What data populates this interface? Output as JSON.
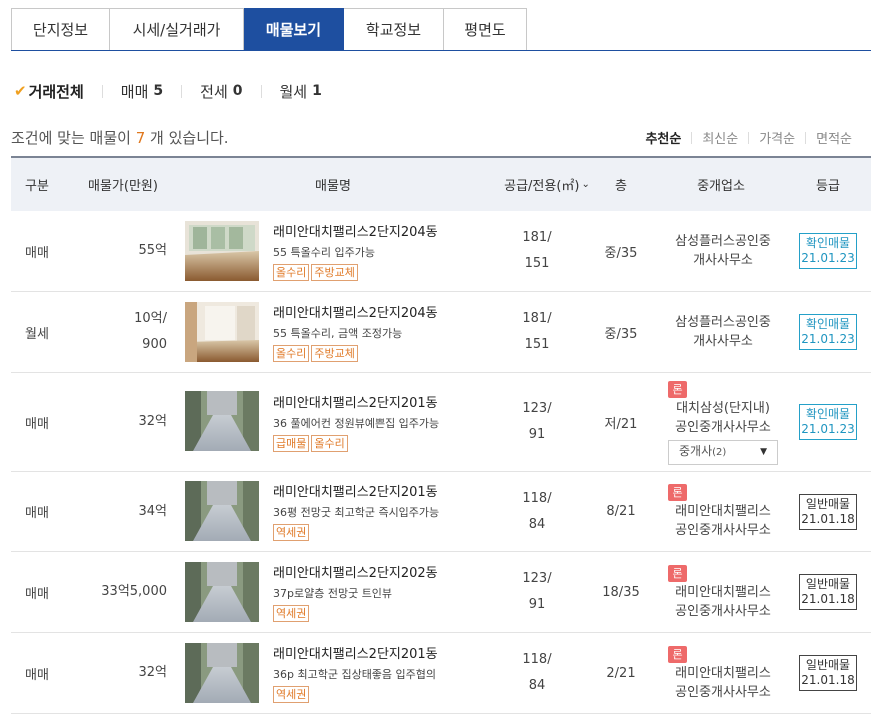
{
  "tabs": [
    "단지정보",
    "시세/실거래가",
    "매물보기",
    "학교정보",
    "평면도"
  ],
  "filters": [
    {
      "label": "거래전체",
      "count": ""
    },
    {
      "label": "매매",
      "count": "5"
    },
    {
      "label": "전세",
      "count": "0"
    },
    {
      "label": "월세",
      "count": "1"
    }
  ],
  "count_line": {
    "prefix": "조건에 맞는 매물이 ",
    "num": "7",
    "suffix": " 개 있습니다."
  },
  "sorts": [
    "추천순",
    "최신순",
    "가격순",
    "면적순"
  ],
  "headers": {
    "type": "구분",
    "price": "매물가(만원)",
    "name": "매물명",
    "area": "공급/전용(㎡)",
    "floor": "층",
    "agent": "중개업소",
    "grade": "등급"
  },
  "colors": {
    "accent": "#1e4fa0",
    "count": "#e0781e",
    "tag": "#e07a28",
    "ron": "#ee6a6a",
    "confirmed": "#1f95c0"
  },
  "listings": [
    {
      "type": "매매",
      "price1": "55억",
      "price2": "",
      "name": "래미안대치팰리스2단지204동",
      "desc": "55 특올수리 입주가능",
      "tags": [
        "올수리",
        "주방교체"
      ],
      "area1": "181/",
      "area2": "151",
      "floor": "중/35",
      "ron": "",
      "agent1": "삼성플러스공인중",
      "agent2": "개사사무소",
      "select": "",
      "grade1": "확인매물",
      "grade2": "21.01.23"
    },
    {
      "type": "월세",
      "price1": "10억/",
      "price2": "900",
      "name": "래미안대치팰리스2단지204동",
      "desc": "55 특올수리, 금액 조정가능",
      "tags": [
        "올수리",
        "주방교체"
      ],
      "area1": "181/",
      "area2": "151",
      "floor": "중/35",
      "ron": "",
      "agent1": "삼성플러스공인중",
      "agent2": "개사사무소",
      "select": "",
      "grade1": "확인매물",
      "grade2": "21.01.23"
    },
    {
      "type": "매매",
      "price1": "32억",
      "price2": "",
      "name": "래미안대치팰리스2단지201동",
      "desc": "36 풀에어컨 정원뷰예쁜집 입주가능",
      "tags": [
        "급매물",
        "올수리"
      ],
      "area1": "123/",
      "area2": "91",
      "floor": "저/21",
      "ron": "론",
      "agent1": "대치삼성(단지내)",
      "agent2": "공인중개사사무소",
      "select": "중개사",
      "select_sub": "(2)",
      "grade1": "확인매물",
      "grade2": "21.01.23"
    },
    {
      "type": "매매",
      "price1": "34억",
      "price2": "",
      "name": "래미안대치팰리스2단지201동",
      "desc": "36평 전망굿 최고학군 즉시입주가능",
      "tags": [
        "역세권"
      ],
      "area1": "118/",
      "area2": "84",
      "floor": "8/21",
      "ron": "론",
      "agent1": "래미안대치팰리스",
      "agent2": "공인중개사사무소",
      "select": "",
      "grade1": "일반매물",
      "grade2": "21.01.18"
    },
    {
      "type": "매매",
      "price1": "33억5,000",
      "price2": "",
      "name": "래미안대치팰리스2단지202동",
      "desc": "37p로얄층 전망굿 트인뷰",
      "tags": [
        "역세권"
      ],
      "area1": "123/",
      "area2": "91",
      "floor": "18/35",
      "ron": "론",
      "agent1": "래미안대치팰리스",
      "agent2": "공인중개사사무소",
      "select": "",
      "grade1": "일반매물",
      "grade2": "21.01.18"
    },
    {
      "type": "매매",
      "price1": "32억",
      "price2": "",
      "name": "래미안대치팰리스2단지201동",
      "desc": "36p 최고학군 집상태좋음 입주협의",
      "tags": [
        "역세권"
      ],
      "area1": "118/",
      "area2": "84",
      "floor": "2/21",
      "ron": "론",
      "agent1": "래미안대치팰리스",
      "agent2": "공인중개사사무소",
      "select": "",
      "grade1": "일반매물",
      "grade2": "21.01.18"
    }
  ]
}
